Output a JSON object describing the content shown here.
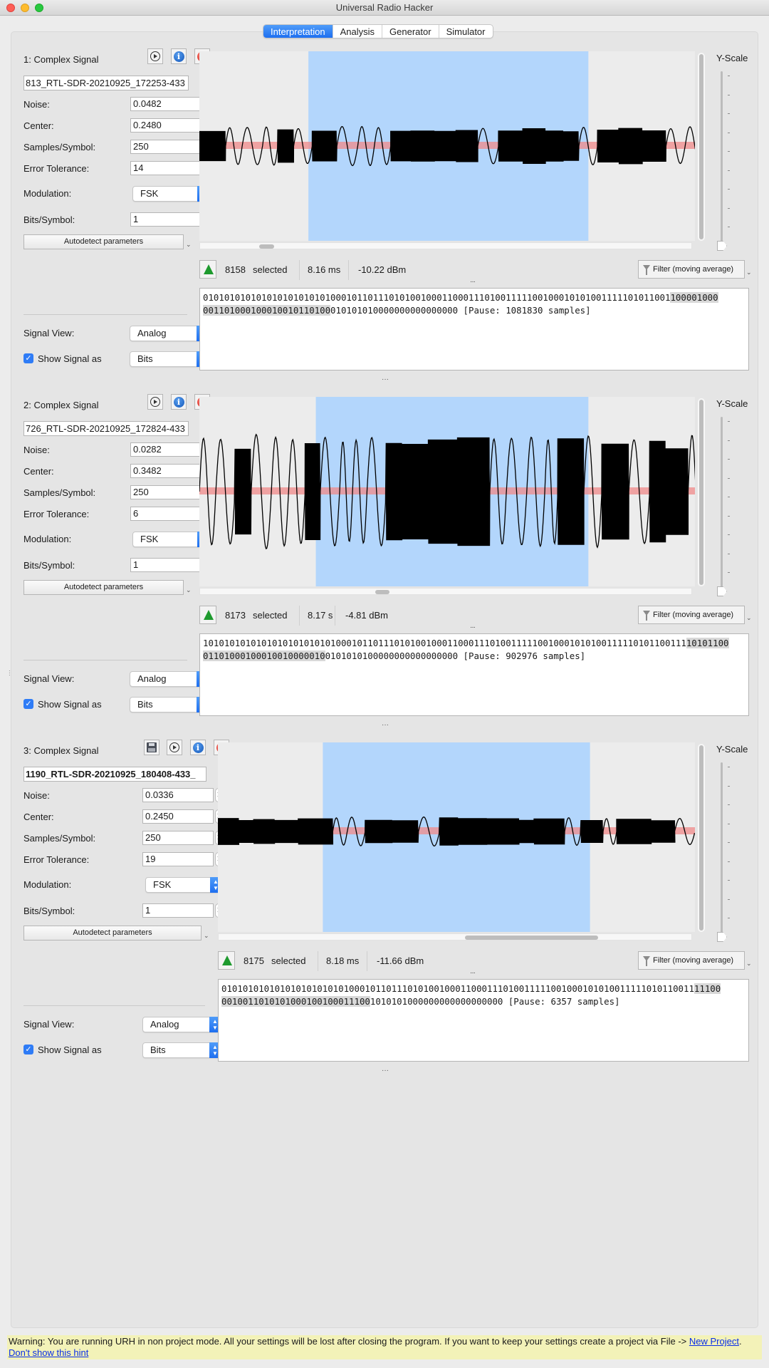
{
  "window": {
    "title": "Universal Radio Hacker"
  },
  "tabs": [
    {
      "label": "Interpretation",
      "active": true
    },
    {
      "label": "Analysis",
      "active": false
    },
    {
      "label": "Generator",
      "active": false
    },
    {
      "label": "Simulator",
      "active": false
    }
  ],
  "colors": {
    "accent": "#1e6ff0",
    "selection": "#b3d6fc",
    "center_line": "#f08a8a",
    "waveform": "#000000",
    "warning_bg": "#f3f2b8"
  },
  "labels": {
    "noise": "Noise:",
    "center": "Center:",
    "samples_per_symbol": "Samples/Symbol:",
    "error_tolerance": "Error Tolerance:",
    "modulation": "Modulation:",
    "bits_per_symbol": "Bits/Symbol:",
    "autodetect": "Autodetect parameters",
    "signal_view": "Signal View:",
    "show_signal_as": "Show Signal as",
    "y_scale": "Y-Scale",
    "selected": "selected",
    "filter": "Filter (moving average)"
  },
  "signals": [
    {
      "title": "1:  Complex Signal",
      "has_save": false,
      "filename": "813_RTL-SDR-20210925_172253-433",
      "noise": "0.0482",
      "center": "0.2480",
      "samples_per_symbol": "250",
      "error_tolerance": "14",
      "modulation": "FSK",
      "bits_per_symbol": "1",
      "signal_view": "Analog",
      "show_signal_as_checked": true,
      "show_signal_as": "Bits",
      "selected_count": "8158",
      "duration": "8.16 ms",
      "power": "-10.22 dBm",
      "bits_line1_plain": "0101010101010101010101010001011011101010010001100011101001111100100010101001111101011001",
      "bits_line1_hl": "100001000",
      "bits_line2_hl": "001101000100010010110100",
      "bits_line2_plain": "010101010000000000000000 [Pause: 1081830 samples]",
      "selection_range": [
        0.22,
        0.785
      ],
      "center_level": 0.5,
      "hscroll_thumb": [
        0.12,
        0.15
      ]
    },
    {
      "title": "2:  Complex Signal",
      "has_save": false,
      "filename": "726_RTL-SDR-20210925_172824-433",
      "noise": "0.0282",
      "center": "0.3482",
      "samples_per_symbol": "250",
      "error_tolerance": "6",
      "modulation": "FSK",
      "bits_per_symbol": "1",
      "signal_view": "Analog",
      "show_signal_as_checked": true,
      "show_signal_as": "Bits",
      "selected_count": "8173",
      "duration": "8.17 s",
      "power": "-4.81 dBm",
      "bits_line1_plain": "1010101010101010101010101000101101110101001000110001110100111110010001010100111110101100111",
      "bits_line1_hl": "10101100",
      "bits_line2_hl": "01101000100010010000010",
      "bits_line2_plain": "0101010100000000000000000 [Pause: 902976 samples]",
      "selection_range": [
        0.235,
        0.785
      ],
      "center_level": 0.5,
      "hscroll_thumb": [
        0.355,
        0.385
      ]
    },
    {
      "title": "3:  Complex Signal",
      "has_save": true,
      "filename": "1190_RTL-SDR-20210925_180408-433_",
      "noise": "0.0336",
      "center": "0.2450",
      "samples_per_symbol": "250",
      "error_tolerance": "19",
      "modulation": "FSK",
      "bits_per_symbol": "1",
      "signal_view": "Analog",
      "show_signal_as_checked": true,
      "show_signal_as": "Bits",
      "selected_count": "8175",
      "duration": "8.18 ms",
      "power": "-11.66 dBm",
      "bits_line1_plain": "01010101010101010101010100010110111010100100011000111010011111001000101010011111010110011",
      "bits_line1_hl": "11100",
      "bits_line2_hl": "0010011010101000100100011100",
      "bits_line2_plain": "1010101000000000000000000 [Pause: 6357 samples]",
      "selection_range": [
        0.22,
        0.78
      ],
      "center_level": 0.5,
      "hscroll_thumb": [
        0.52,
        0.8
      ]
    }
  ],
  "warning": {
    "text": "Warning: You are running URH in non project mode. All your settings will be lost after closing the program. If you want to keep your settings create a project via File -> ",
    "link_new_project": "New Project",
    "separator": ". ",
    "link_dont_show": "Don't show this hint"
  }
}
